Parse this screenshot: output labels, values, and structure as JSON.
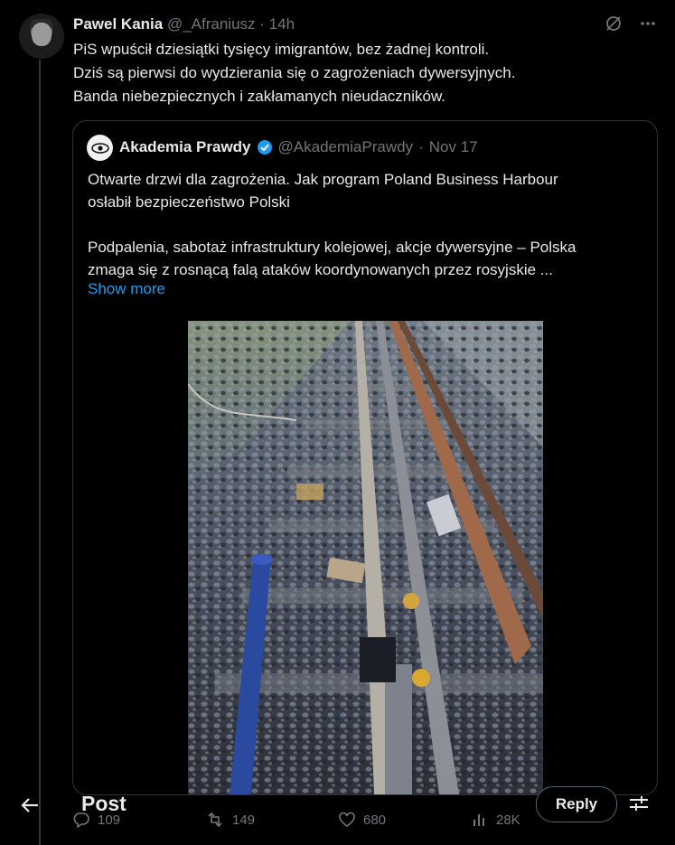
{
  "tweet": {
    "author_name": "Pawel Kania",
    "handle": "@_Afraniusz",
    "separator": "·",
    "time": "14h",
    "lines": [
      "PiS wpuścił dziesiątki tysięcy imigrantów, bez żadnej kontroli.",
      "Dziś są pierwsi do wydzierania się o zagrożeniach dywersyjnych.",
      "Banda niebezpiecznych i zakłamanych nieudaczników."
    ]
  },
  "quote": {
    "author_name": "Akademia Prawdy",
    "handle": "@AkademiaPrawdy",
    "separator": "·",
    "date": "Nov 17",
    "lines": [
      "Otwarte drzwi dla zagrożenia. Jak program Poland Business Harbour",
      "osłabił bezpieczeństwo Polski",
      "",
      "Podpalenia, sabotaż infrastruktury kolejowej, akcje dywersyjne – Polska",
      "zmaga się z rosnącą falą ataków koordynowanych przez rosyjskie ..."
    ],
    "show_more": "Show more"
  },
  "actions": {
    "replies": "109",
    "reposts": "149",
    "likes": "680",
    "views": "28K"
  },
  "bottom_bar": {
    "title": "Post",
    "reply_label": "Reply"
  },
  "icons": {
    "verified": "verified-badge-icon",
    "grok": "grok-icon",
    "more": "more-icon",
    "back": "back-arrow-icon",
    "filter": "filter-icon"
  },
  "colors": {
    "accent": "#1d9bf0",
    "muted": "#71767b",
    "border": "#2f3336"
  }
}
